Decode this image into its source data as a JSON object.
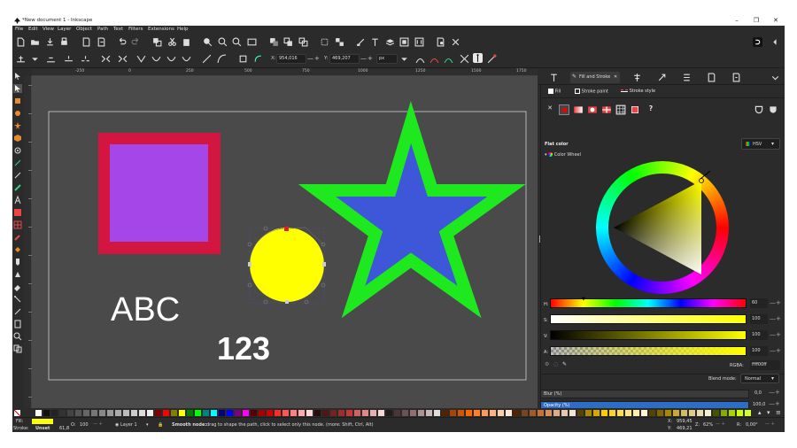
{
  "window": {
    "title": "*New document 1 - Inkscape",
    "minimize": "–",
    "maximize": "❐",
    "close": "✕"
  },
  "menu": [
    "File",
    "Edit",
    "View",
    "Layer",
    "Object",
    "Path",
    "Text",
    "Filters",
    "Extensions",
    "Help"
  ],
  "controls": {
    "x_label": "X:",
    "x_value": "954,016",
    "y_label": "Y:",
    "y_value": "469,207",
    "unit": "px"
  },
  "ruler": {
    "h": [
      "-250",
      "0",
      "250",
      "500",
      "750",
      "1000",
      "1250",
      "1500",
      "1750"
    ]
  },
  "canvas": {
    "text_abc": "ABC",
    "text_123": "123",
    "colors": {
      "square_outer": "#d3163f",
      "square_inner": "#a547e8",
      "circle": "#ffff00",
      "star_fill": "#3e56d8",
      "star_stroke": "#1ee81e",
      "background": "#4a4a4a",
      "text": "#ffffff"
    }
  },
  "dock": {
    "tab_active": "Fill and Stroke",
    "tab_close": "✕"
  },
  "fill_stroke": {
    "tab_fill": "Fill",
    "tab_stroke_paint": "Stroke paint",
    "tab_stroke_style": "Stroke style",
    "flat_color": "Flat color",
    "color_mode": "HSV",
    "color_wheel": "Color Wheel",
    "unknown_button": "?",
    "sliders": [
      {
        "label": "H:",
        "value": "60"
      },
      {
        "label": "S:",
        "value": "100"
      },
      {
        "label": "V:",
        "value": "100"
      },
      {
        "label": "A:",
        "value": "100"
      }
    ],
    "rgba_label": "RGBA:",
    "rgba_value": "ffff00ff",
    "blend_mode_label": "Blend mode:",
    "blend_mode_value": "Normal",
    "blur_label": "Blur (%)",
    "blur_value": "0,0",
    "opacity_label": "Opacity (%)",
    "opacity_value": "100,0"
  },
  "status": {
    "fill_label": "Fill:",
    "stroke_label": "Stroke:",
    "stroke_value": "Unset",
    "stroke_width": "61,8",
    "opacity_label": "O:",
    "opacity_value": "100",
    "layer": "Layer 1",
    "message_bold": "Smooth node:",
    "message": "drag to shape the path, click to select only this node. (more: Shift, Ctrl, Alt)",
    "x_label": "X:",
    "x_value": "959,45",
    "y_label": "Y:",
    "y_value": "469,21",
    "zoom_label": "Z:",
    "zoom_value": "62%",
    "rotation_label": "R:",
    "rotation_value": "0,00°",
    "fill_color": "#ffff00"
  }
}
